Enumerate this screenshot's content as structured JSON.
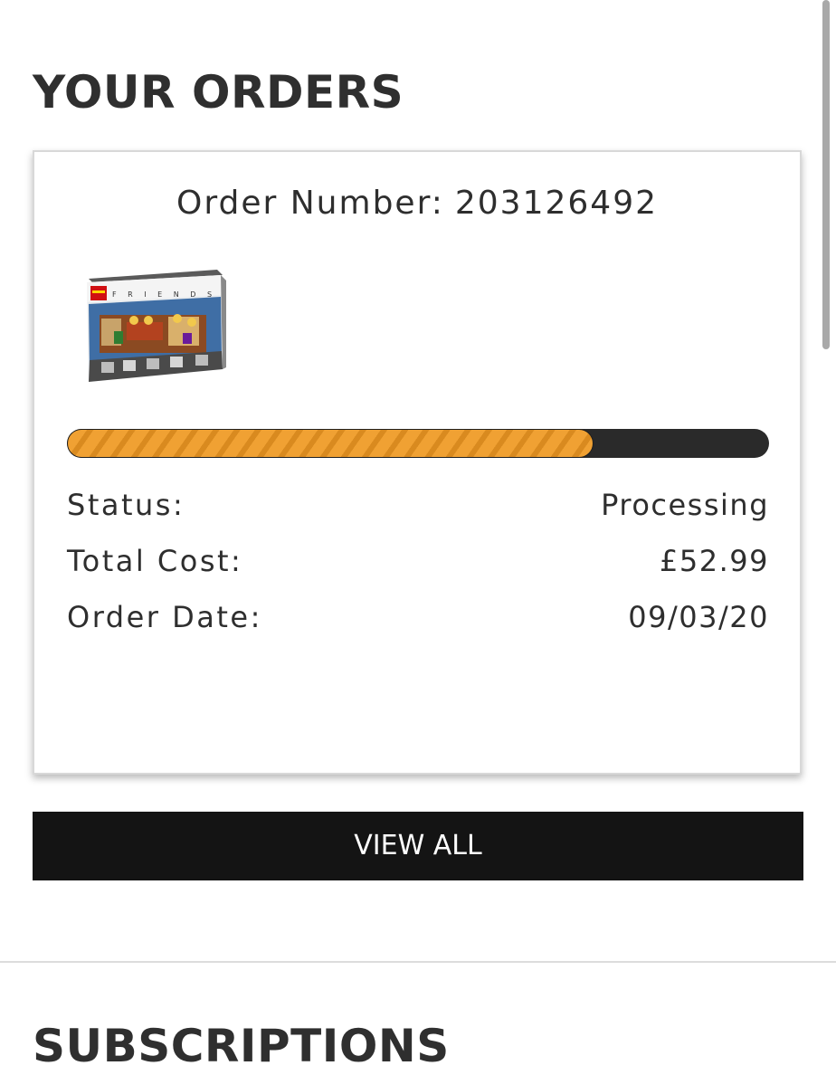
{
  "header": {
    "title": "YOUR ORDERS"
  },
  "order": {
    "number_label": "Order Number:",
    "number": "203126492",
    "product_image": "lego-friends-central-perk-box-image",
    "progress_fraction": 0.75,
    "status_label": "Status:",
    "status_value": "Processing",
    "total_label": "Total Cost:",
    "total_value": "£52.99",
    "date_label": "Order Date:",
    "date_value": "09/03/20"
  },
  "actions": {
    "view_all_label": "VIEW ALL"
  },
  "next_section": {
    "title": "SUBSCRIPTIONS"
  },
  "colors": {
    "progress_fill": "#f0a133",
    "progress_track": "#2a2a2a",
    "button_bg": "#141414",
    "button_text": "#ffffff"
  }
}
